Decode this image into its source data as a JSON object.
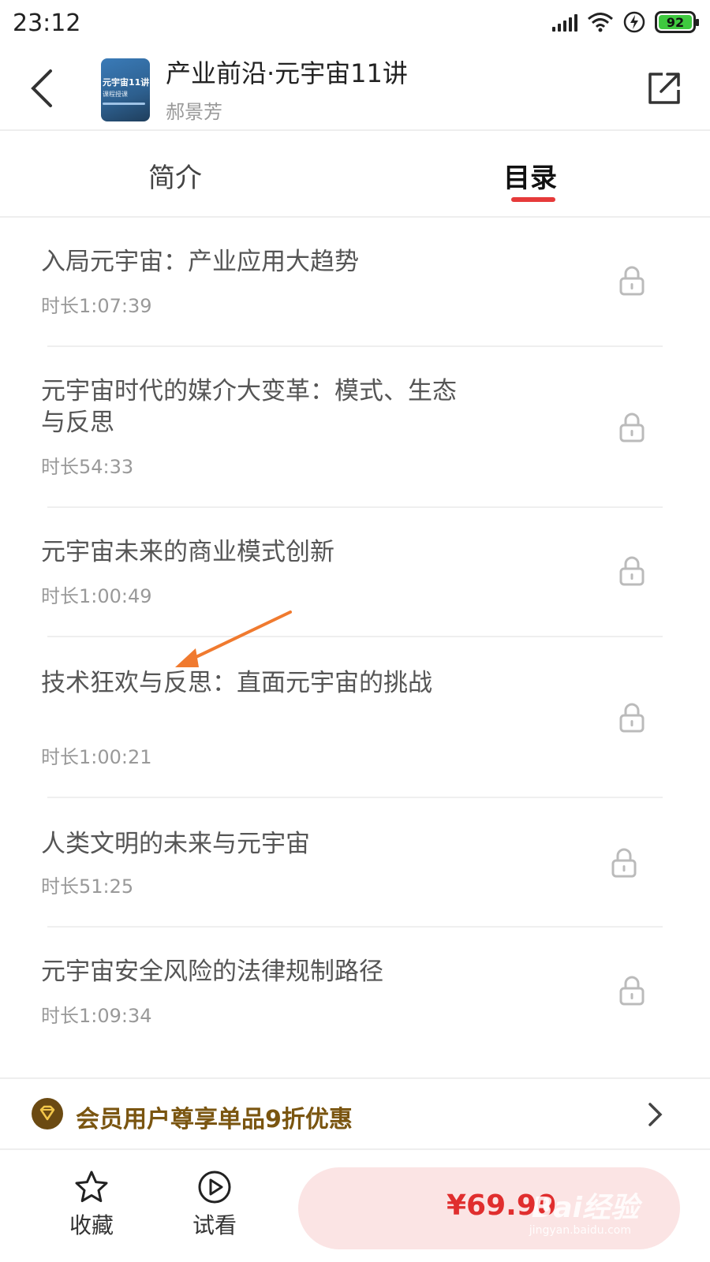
{
  "status": {
    "time": "23:12",
    "battery": "92"
  },
  "header": {
    "title": "产业前沿·元宇宙11讲",
    "author": "郝景芳",
    "cover_title": "元宇宙11讲",
    "cover_sub": "课程授课"
  },
  "tabs": [
    {
      "label": "简介"
    },
    {
      "label": "目录",
      "active": true
    }
  ],
  "lessons": [
    {
      "title": "入局元宇宙：产业应用大趋势",
      "duration": "时长1:07:39",
      "locked": true
    },
    {
      "title": "元宇宙时代的媒介大变革：模式、生态与反思",
      "duration": "时长54:33",
      "locked": true
    },
    {
      "title": "元宇宙未来的商业模式创新",
      "duration": "时长1:00:49",
      "locked": true
    },
    {
      "title": "技术狂欢与反思：直面元宇宙的挑战",
      "duration": "时长1:00:21",
      "locked": true
    },
    {
      "title": "人类文明的未来与元宇宙",
      "duration": "时长51:25",
      "locked": true
    },
    {
      "title": "元宇宙安全风险的法律规制路径",
      "duration": "时长1:09:34",
      "locked": true
    }
  ],
  "member": {
    "text": "会员用户尊享单品9折优惠"
  },
  "bottom": {
    "favorite_label": "收藏",
    "trial_label": "试看",
    "price": "¥69.90"
  },
  "watermark": {
    "brand": "Bai经验",
    "url": "jingyan.baidu.com"
  },
  "colors": {
    "accent": "#e63a3a",
    "member_gold": "#7a5510",
    "buy_bg": "#fbe4e4",
    "annotation_arrow": "#f07a2f"
  }
}
